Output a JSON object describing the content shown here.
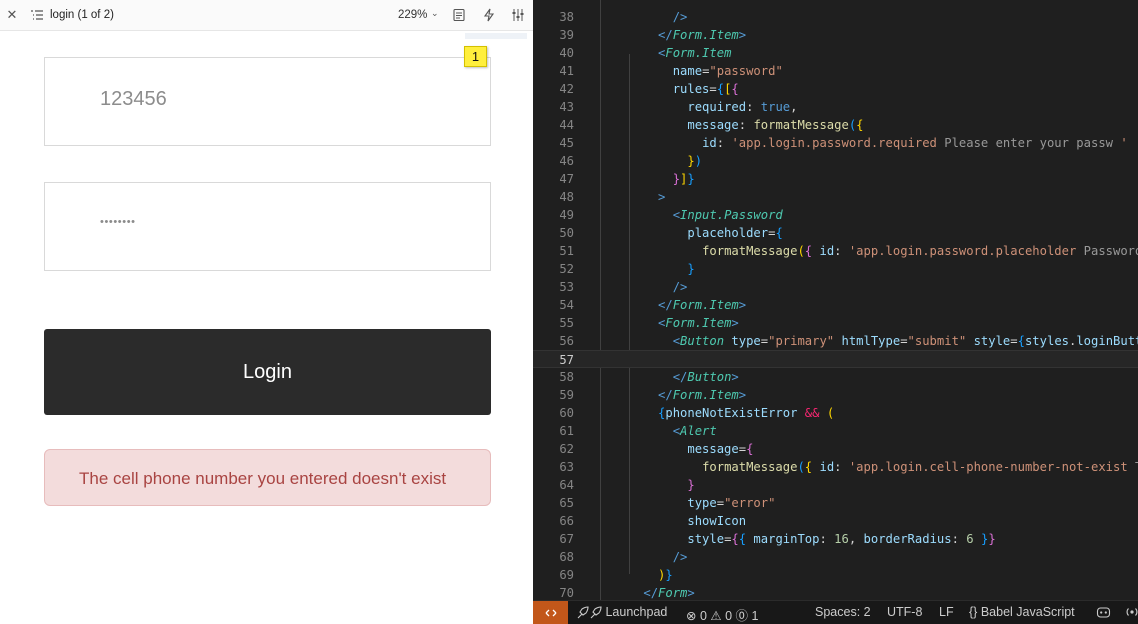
{
  "preview": {
    "title": "login (1 of 2)",
    "zoom": "229%",
    "page_badge": "1",
    "form": {
      "phone_value": "123456",
      "password_mask": "••••••••",
      "login_label": "Login",
      "error_message": "The cell phone number you entered doesn't exist"
    }
  },
  "editor": {
    "lines": [
      {
        "n": "38",
        "segs": [
          [
            "        ",
            "tk-op"
          ],
          [
            "/>",
            "tk-tag"
          ]
        ]
      },
      {
        "n": "39",
        "segs": [
          [
            "      ",
            "tk-op"
          ],
          [
            "</",
            "tk-tag"
          ],
          [
            "Form.Item",
            "tk-comp"
          ],
          [
            ">",
            "tk-tag"
          ]
        ]
      },
      {
        "n": "40",
        "segs": [
          [
            "      ",
            "tk-op"
          ],
          [
            "<",
            "tk-tag"
          ],
          [
            "Form.Item",
            "tk-comp"
          ]
        ]
      },
      {
        "n": "41",
        "segs": [
          [
            "        ",
            "tk-op"
          ],
          [
            "name",
            "tk-attr"
          ],
          [
            "=",
            "tk-op"
          ],
          [
            "\"password\"",
            "tk-str"
          ]
        ]
      },
      {
        "n": "42",
        "segs": [
          [
            "        ",
            "tk-op"
          ],
          [
            "rules",
            "tk-attr"
          ],
          [
            "=",
            "tk-op"
          ],
          [
            "{",
            "tk-br3"
          ],
          [
            "[",
            "tk-br1"
          ],
          [
            "{",
            "tk-br2"
          ]
        ]
      },
      {
        "n": "43",
        "segs": [
          [
            "          ",
            "tk-op"
          ],
          [
            "required",
            "tk-attr"
          ],
          [
            ": ",
            "tk-op"
          ],
          [
            "true",
            "tk-tag"
          ],
          [
            ",",
            "tk-op"
          ]
        ]
      },
      {
        "n": "44",
        "segs": [
          [
            "          ",
            "tk-op"
          ],
          [
            "message",
            "tk-attr"
          ],
          [
            ": ",
            "tk-op"
          ],
          [
            "formatMessage",
            "tk-fn"
          ],
          [
            "(",
            "tk-br3"
          ],
          [
            "{",
            "tk-br1"
          ]
        ]
      },
      {
        "n": "45",
        "segs": [
          [
            "            ",
            "tk-op"
          ],
          [
            "id",
            "tk-attr"
          ],
          [
            ": ",
            "tk-op"
          ],
          [
            "'app.login.password.required",
            "tk-str"
          ],
          [
            " Please enter your passw ",
            "tk-ph"
          ],
          [
            "'",
            "tk-str"
          ]
        ]
      },
      {
        "n": "46",
        "segs": [
          [
            "          ",
            "tk-op"
          ],
          [
            "}",
            "tk-br1"
          ],
          [
            ")",
            "tk-br3"
          ]
        ]
      },
      {
        "n": "47",
        "segs": [
          [
            "        ",
            "tk-op"
          ],
          [
            "}",
            "tk-br2"
          ],
          [
            "]",
            "tk-br1"
          ],
          [
            "}",
            "tk-br3"
          ]
        ]
      },
      {
        "n": "48",
        "segs": [
          [
            "      ",
            "tk-op"
          ],
          [
            ">",
            "tk-tag"
          ]
        ]
      },
      {
        "n": "49",
        "segs": [
          [
            "        ",
            "tk-op"
          ],
          [
            "<",
            "tk-tag"
          ],
          [
            "Input.Password",
            "tk-comp"
          ]
        ]
      },
      {
        "n": "50",
        "segs": [
          [
            "          ",
            "tk-op"
          ],
          [
            "placeholder",
            "tk-attr"
          ],
          [
            "=",
            "tk-op"
          ],
          [
            "{",
            "tk-br3"
          ]
        ]
      },
      {
        "n": "51",
        "segs": [
          [
            "            ",
            "tk-op"
          ],
          [
            "formatMessage",
            "tk-fn"
          ],
          [
            "(",
            "tk-br1"
          ],
          [
            "{",
            "tk-br2"
          ],
          [
            " id",
            "tk-attr"
          ],
          [
            ": ",
            "tk-op"
          ],
          [
            "'app.login.password.placeholder",
            "tk-str"
          ],
          [
            " Password ",
            "tk-ph"
          ],
          [
            "' ",
            "tk-str"
          ],
          [
            "}",
            "tk-br2"
          ],
          [
            ")",
            "tk-br1"
          ]
        ]
      },
      {
        "n": "52",
        "segs": [
          [
            "          ",
            "tk-op"
          ],
          [
            "}",
            "tk-br3"
          ]
        ]
      },
      {
        "n": "53",
        "segs": [
          [
            "        ",
            "tk-op"
          ],
          [
            "/>",
            "tk-tag"
          ]
        ]
      },
      {
        "n": "54",
        "segs": [
          [
            "      ",
            "tk-op"
          ],
          [
            "</",
            "tk-tag"
          ],
          [
            "Form.Item",
            "tk-comp"
          ],
          [
            ">",
            "tk-tag"
          ]
        ]
      },
      {
        "n": "55",
        "segs": [
          [
            "      ",
            "tk-op"
          ],
          [
            "<",
            "tk-tag"
          ],
          [
            "Form.Item",
            "tk-comp"
          ],
          [
            ">",
            "tk-tag"
          ]
        ]
      },
      {
        "n": "56",
        "segs": [
          [
            "        ",
            "tk-op"
          ],
          [
            "<",
            "tk-tag"
          ],
          [
            "Button",
            "tk-comp"
          ],
          [
            " type",
            "tk-attr"
          ],
          [
            "=",
            "tk-op"
          ],
          [
            "\"primary\"",
            "tk-str"
          ],
          [
            " htmlType",
            "tk-attr"
          ],
          [
            "=",
            "tk-op"
          ],
          [
            "\"submit\"",
            "tk-str"
          ],
          [
            " style",
            "tk-attr"
          ],
          [
            "=",
            "tk-op"
          ],
          [
            "{",
            "tk-br3"
          ],
          [
            "styles",
            "tk-attr"
          ],
          [
            ".",
            "tk-op"
          ],
          [
            "loginButton",
            "tk-attr"
          ],
          [
            "}",
            "tk-br3"
          ],
          [
            ">",
            "tk-tag"
          ]
        ]
      },
      {
        "n": "57",
        "segs": [
          [
            "",
            "tk-op"
          ]
        ],
        "active": true
      },
      {
        "n": "58",
        "segs": [
          [
            "        ",
            "tk-op"
          ],
          [
            "</",
            "tk-tag"
          ],
          [
            "Button",
            "tk-comp"
          ],
          [
            ">",
            "tk-tag"
          ]
        ]
      },
      {
        "n": "59",
        "segs": [
          [
            "      ",
            "tk-op"
          ],
          [
            "</",
            "tk-tag"
          ],
          [
            "Form.Item",
            "tk-comp"
          ],
          [
            ">",
            "tk-tag"
          ]
        ]
      },
      {
        "n": "60",
        "segs": [
          [
            "      ",
            "tk-op"
          ],
          [
            "{",
            "tk-br3"
          ],
          [
            "phoneNotExistError",
            "tk-attr"
          ],
          [
            " ",
            "tk-op"
          ],
          [
            "&&",
            "tk-amp"
          ],
          [
            " ",
            "tk-op"
          ],
          [
            "(",
            "tk-br1"
          ]
        ]
      },
      {
        "n": "61",
        "segs": [
          [
            "        ",
            "tk-op"
          ],
          [
            "<",
            "tk-tag"
          ],
          [
            "Alert",
            "tk-comp"
          ]
        ]
      },
      {
        "n": "62",
        "segs": [
          [
            "          ",
            "tk-op"
          ],
          [
            "message",
            "tk-attr"
          ],
          [
            "=",
            "tk-op"
          ],
          [
            "{",
            "tk-br2"
          ]
        ]
      },
      {
        "n": "63",
        "segs": [
          [
            "            ",
            "tk-op"
          ],
          [
            "formatMessage",
            "tk-fn"
          ],
          [
            "(",
            "tk-br3"
          ],
          [
            "{",
            "tk-br1"
          ],
          [
            " id",
            "tk-attr"
          ],
          [
            ": ",
            "tk-op"
          ],
          [
            "'app.login.cell-phone-number-not-exist",
            "tk-str"
          ],
          [
            " The ce",
            "tk-ph"
          ]
        ]
      },
      {
        "n": "64",
        "segs": [
          [
            "          ",
            "tk-op"
          ],
          [
            "}",
            "tk-br2"
          ]
        ]
      },
      {
        "n": "65",
        "segs": [
          [
            "          ",
            "tk-op"
          ],
          [
            "type",
            "tk-attr"
          ],
          [
            "=",
            "tk-op"
          ],
          [
            "\"error\"",
            "tk-str"
          ]
        ]
      },
      {
        "n": "66",
        "segs": [
          [
            "          ",
            "tk-op"
          ],
          [
            "showIcon",
            "tk-attr"
          ]
        ]
      },
      {
        "n": "67",
        "segs": [
          [
            "          ",
            "tk-op"
          ],
          [
            "style",
            "tk-attr"
          ],
          [
            "=",
            "tk-op"
          ],
          [
            "{",
            "tk-br2"
          ],
          [
            "{",
            "tk-br3"
          ],
          [
            " marginTop",
            "tk-attr"
          ],
          [
            ": ",
            "tk-op"
          ],
          [
            "16",
            "tk-num"
          ],
          [
            ", ",
            "tk-op"
          ],
          [
            "borderRadius",
            "tk-attr"
          ],
          [
            ": ",
            "tk-op"
          ],
          [
            "6",
            "tk-num"
          ],
          [
            " ",
            "tk-op"
          ],
          [
            "}",
            "tk-br3"
          ],
          [
            "}",
            "tk-br2"
          ]
        ]
      },
      {
        "n": "68",
        "segs": [
          [
            "        ",
            "tk-op"
          ],
          [
            "/>",
            "tk-tag"
          ]
        ]
      },
      {
        "n": "69",
        "segs": [
          [
            "      ",
            "tk-op"
          ],
          [
            ")",
            "tk-br1"
          ],
          [
            "}",
            "tk-br3"
          ]
        ]
      },
      {
        "n": "70",
        "segs": [
          [
            "    ",
            "tk-op"
          ],
          [
            "</",
            "tk-tag"
          ],
          [
            "Form",
            "tk-comp"
          ],
          [
            ">",
            "tk-tag"
          ]
        ]
      }
    ]
  },
  "statusbar": {
    "remote_icon": "remote-icon",
    "launchpad": "Launchpad",
    "errors": "0",
    "warnings": "0",
    "info": "1",
    "spaces": "Spaces: 2",
    "encoding": "UTF-8",
    "eol": "LF",
    "language": "Babel JavaScript"
  }
}
